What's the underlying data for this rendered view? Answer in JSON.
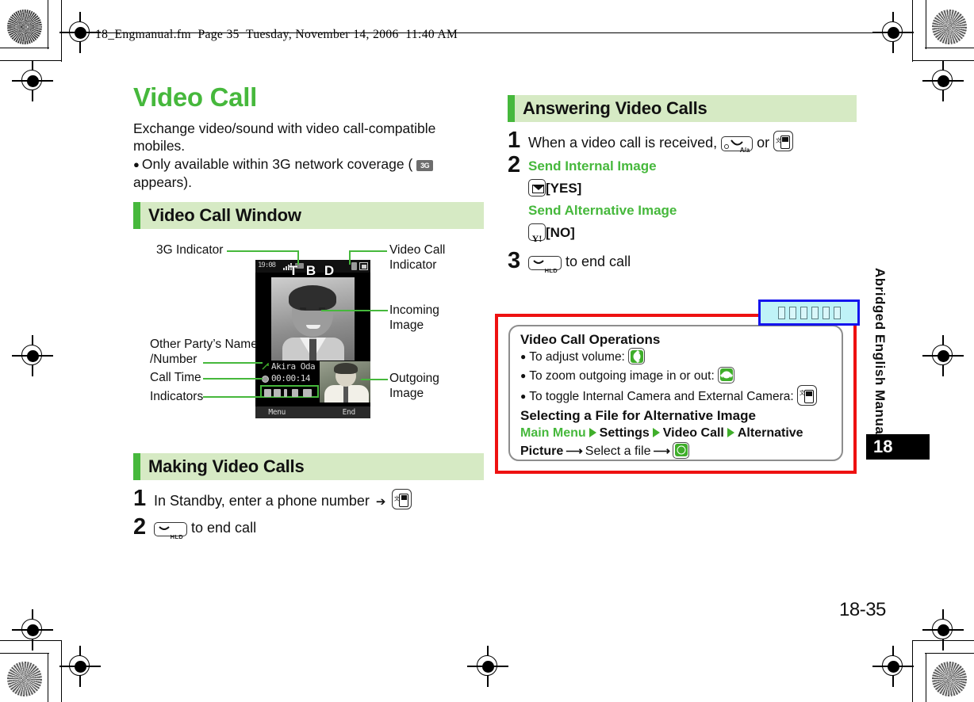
{
  "document_header": "18_Engmanual.fm  Page 35  Tuesday, November 14, 2006  11:40 AM",
  "page_number": "18-35",
  "sidebar": {
    "manual_label": "Abridged English Manual",
    "chapter_number": "18"
  },
  "left_column": {
    "title": "Video Call",
    "lead_line1": "Exchange video/sound with video call-compatible",
    "lead_line2": "mobiles.",
    "bullet_pre": "Only available within 3G network coverage (",
    "bullet_icon": "3g-indicator-icon",
    "bullet_icon_text": "3G",
    "bullet_post": "appears).",
    "section_window": "Video Call Window",
    "section_making": "Making Video Calls",
    "making_steps": [
      {
        "num": "1",
        "text_pre": "In Standby, enter a phone number",
        "arrow": "➔",
        "icon": "video-call-key-icon",
        "text_post": ""
      },
      {
        "num": "2",
        "text_pre": "",
        "icon": "end-call-key-icon",
        "text_post": "to end call"
      }
    ]
  },
  "phone_callouts": {
    "three_g": "3G Indicator",
    "video_call_indicator_l1": "Video Call",
    "video_call_indicator_l2": "Indicator",
    "incoming_l1": "Incoming",
    "incoming_l2": "Image",
    "other_party_l1": "Other Party’s Name",
    "other_party_l2": "/Number",
    "call_time": "Call Time",
    "indicators": "Indicators",
    "outgoing_l1": "Outgoing",
    "outgoing_l2": "Image"
  },
  "phone_screen": {
    "status_time": "19:08",
    "overlay_text": "T B D",
    "caller_name": "Akira Oda",
    "call_duration": "00:00:14",
    "softkey_left": "Menu",
    "softkey_right": "End"
  },
  "right_column": {
    "section_answering": "Answering Video Calls",
    "steps": [
      {
        "num": "1",
        "text_pre": "When a video call is received,",
        "icon_a": "send-key-icon",
        "or_text": "or",
        "icon_b": "video-call-key-icon"
      },
      {
        "num": "2",
        "option1_label": "Send Internal Image",
        "option1_key": "mail-key-icon",
        "option1_action": "[YES]",
        "option2_label": "Send Alternative Image",
        "option2_key": "yahoo-key-icon",
        "option2_action": "[NO]"
      },
      {
        "num": "3",
        "icon": "end-call-key-icon",
        "text_post": "to end call"
      }
    ]
  },
  "operations_box": {
    "title": "Video Call Operations",
    "bullets": [
      {
        "text": "To adjust volume:",
        "icon": "dpad-up-down-icon"
      },
      {
        "text": "To zoom outgoing image in or out:",
        "icon": "dpad-left-right-icon"
      },
      {
        "text": "To toggle Internal Camera and External Camera:",
        "icon": "video-call-key-icon"
      }
    ],
    "subtitle": "Selecting a File for Alternative Image",
    "path": {
      "p1": "Main Menu",
      "p2": "Settings",
      "p3": "Video Call",
      "p4": "Alternative",
      "p5": "Picture",
      "p6": "Select a file",
      "final_icon": "dpad-center-icon"
    }
  },
  "tofu_box": {
    "glyph_count": 6,
    "border_color": "#1414ee",
    "fill_color": "#bff3f7"
  },
  "colors": {
    "accent_green": "#46b83c",
    "section_bg": "#d6eac4",
    "highlight_red": "#ee1111"
  }
}
